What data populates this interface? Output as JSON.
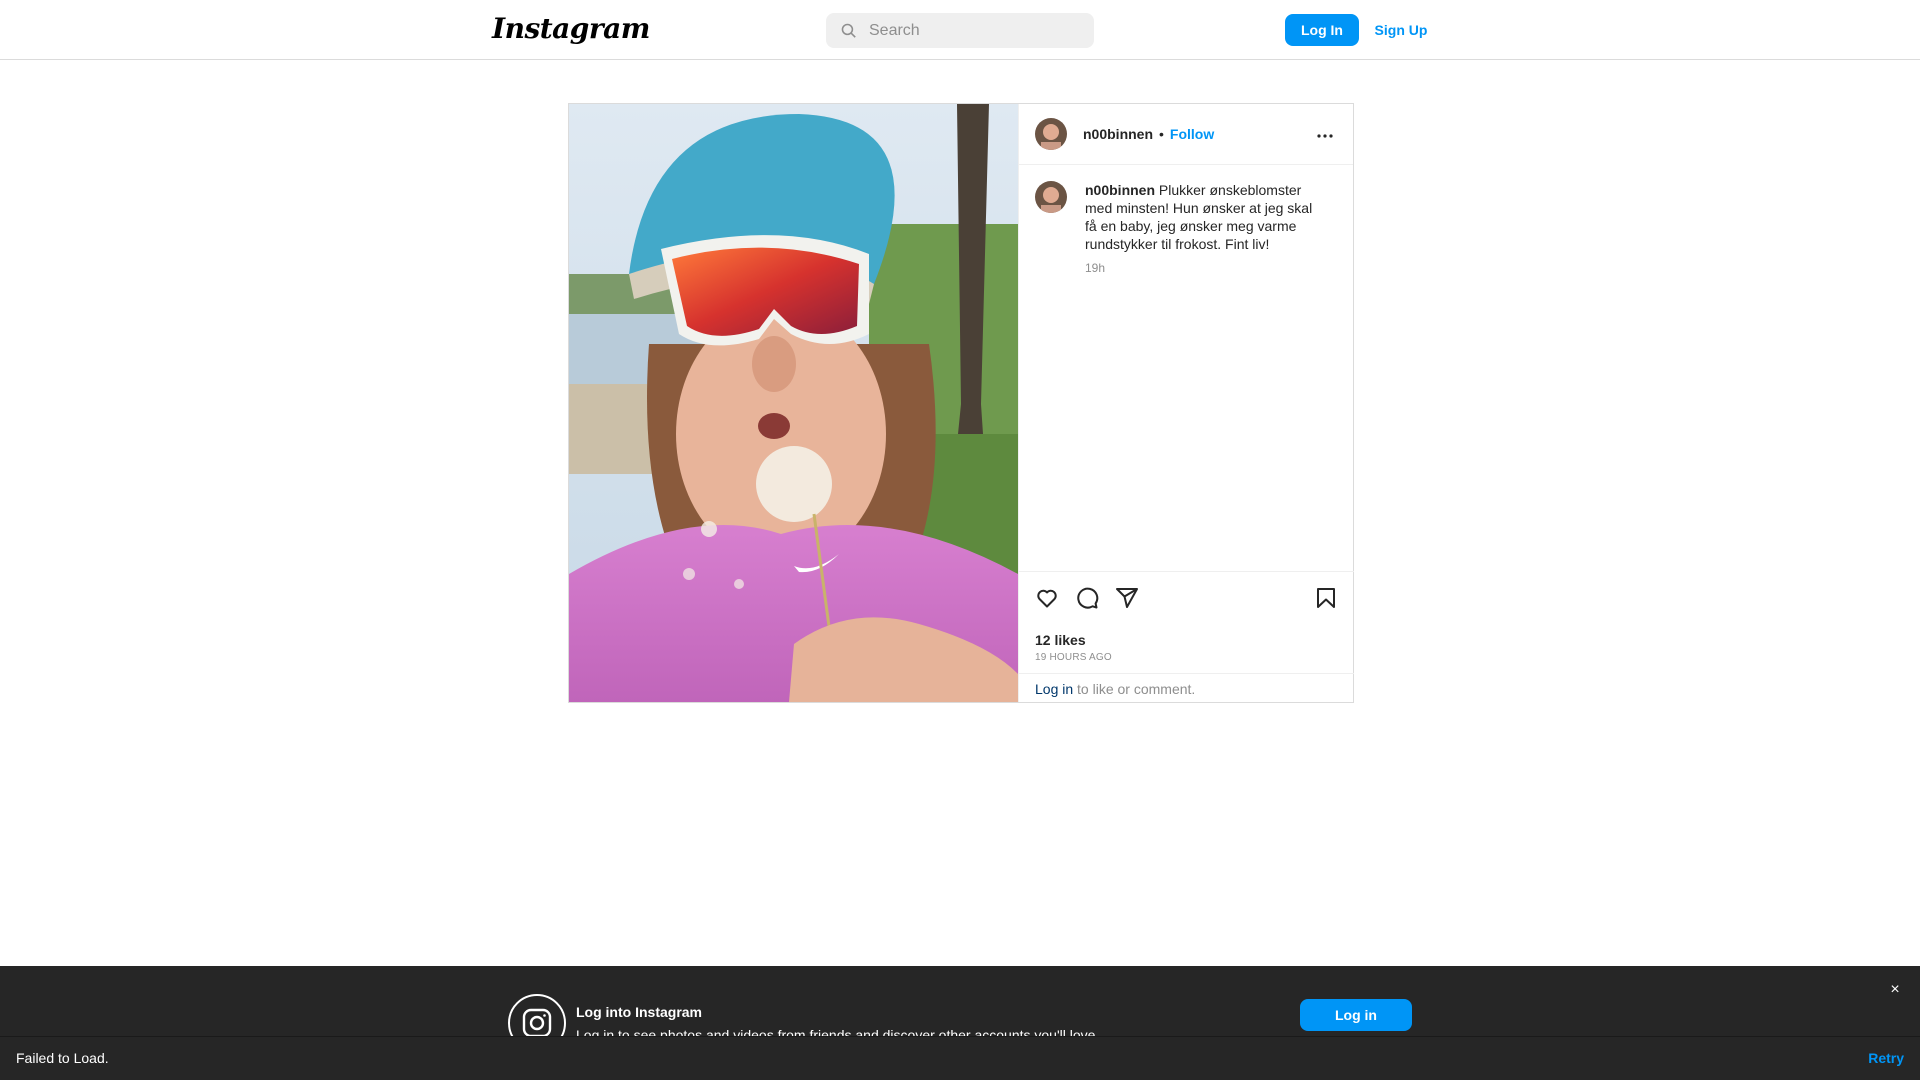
{
  "nav": {
    "logo": "Instagram",
    "search_placeholder": "Search",
    "login_label": "Log In",
    "signup_label": "Sign Up"
  },
  "post": {
    "username": "n00binnen",
    "separator": "•",
    "follow_label": "Follow",
    "caption_username": "n00binnen",
    "caption_text": "Plukker ønskeblomster med minsten! Hun ønsker at jeg skal få en baby, jeg ønsker meg varme rundstykker til frokost. Fint liv!",
    "caption_time": "19h",
    "likes": "12 likes",
    "time_ago": "19 HOURS AGO",
    "login_link": "Log in",
    "login_prompt": " to like or comment.",
    "icons": [
      "heart-icon",
      "comment-icon",
      "share-icon",
      "bookmark-icon",
      "more-options-icon"
    ]
  },
  "banner": {
    "title": "Log into Instagram",
    "subtitle": "Log in to see photos and videos from friends and discover other accounts you'll love.",
    "login_label": "Log in",
    "close": "×"
  },
  "toast": {
    "message": "Failed to Load.",
    "retry": "Retry"
  },
  "colors": {
    "accent": "#0095f6",
    "banner_bg": "#262626"
  }
}
